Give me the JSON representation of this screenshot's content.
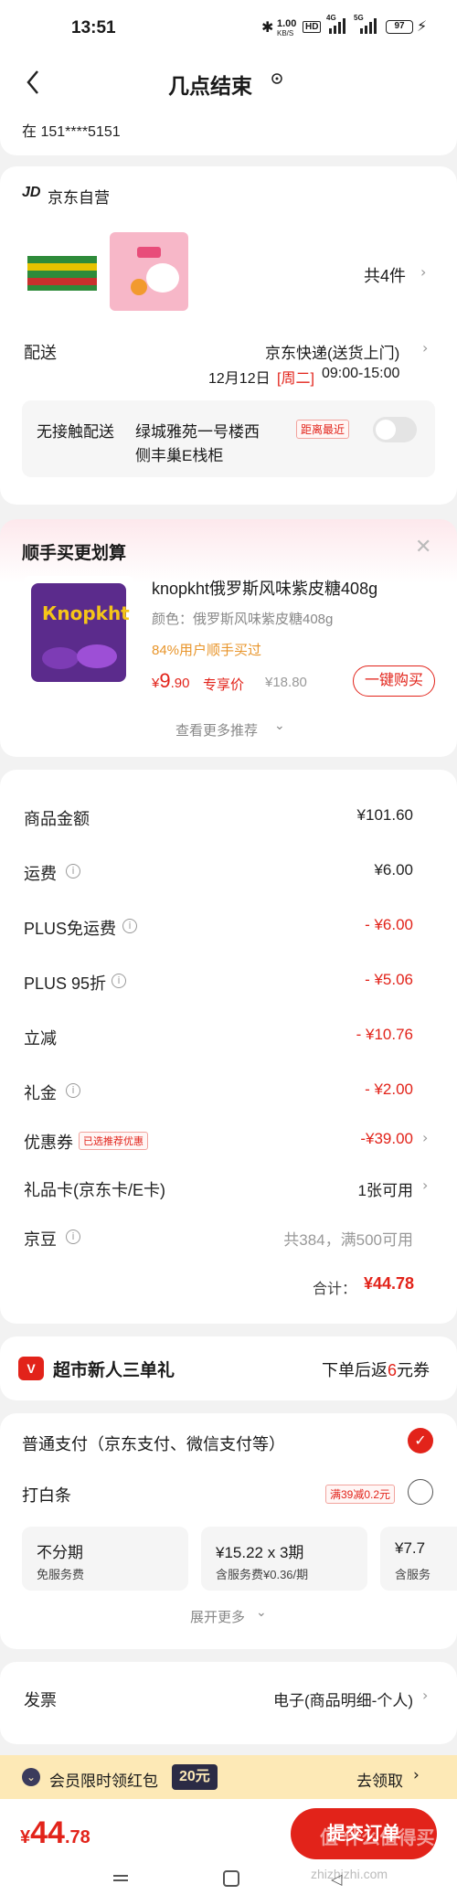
{
  "status_bar": {
    "time": "13:51",
    "net_speed_top": "1.00",
    "net_speed_unit": "KB/S",
    "hd": "HD",
    "sig1": "4G",
    "sig2": "5G",
    "battery": "97"
  },
  "header": {
    "title": "几点结束",
    "address_partial": "在  151****5151"
  },
  "store": {
    "logo": "JD",
    "name": "京东自营",
    "count_text": "共4件"
  },
  "delivery": {
    "label": "配送",
    "method": "京东快递(送货上门)",
    "date": "12月12日",
    "weekday": "[周二]",
    "time": "09:00-15:00",
    "contactless_label": "无接触配送",
    "location_line1": "绿城雅苑一号楼西",
    "location_line2": "侧丰巢E栈柜",
    "nearest_tag": "距离最近"
  },
  "addon": {
    "section_title": "顺手买更划算",
    "product_name": "knopkht俄罗斯风味紫皮糖408g",
    "variant": "颜色：俄罗斯风味紫皮糖408g",
    "social_proof": "84%用户顺手买过",
    "price_symbol": "¥",
    "price_int": "9",
    "price_dec": ".90",
    "price_tag": "专享价",
    "original_price": "¥18.80",
    "buy_button": "一键购买",
    "more": "查看更多推荐"
  },
  "summary": {
    "rows": [
      {
        "label": "商品金额",
        "value": "¥101.60",
        "red": false,
        "info": false
      },
      {
        "label": "运费",
        "value": "¥6.00",
        "red": false,
        "info": true
      },
      {
        "label": "PLUS免运费",
        "value": "- ¥6.00",
        "red": true,
        "info": true
      },
      {
        "label": "PLUS 95折",
        "value": "- ¥5.06",
        "red": true,
        "info": true
      },
      {
        "label": "立减",
        "value": "- ¥10.76",
        "red": true,
        "info": false
      },
      {
        "label": "礼金",
        "value": "- ¥2.00",
        "red": true,
        "info": true
      }
    ],
    "coupon_label": "优惠券",
    "coupon_tag": "已选推荐优惠",
    "coupon_value": "-¥39.00",
    "giftcard_label": "礼品卡(京东卡/E卡)",
    "giftcard_value": "1张可用",
    "jd_bean_label": "京豆",
    "jd_bean_value": "共384，满500可用",
    "total_label": "合计：",
    "total_value": "¥44.78"
  },
  "newcomer": {
    "title": "超市新人三单礼",
    "right_prefix": "下单后返",
    "right_amount": "6",
    "right_suffix": "元券"
  },
  "payment": {
    "normal_label": "普通支付（京东支付、微信支付等）",
    "baitiao_label": "打白条",
    "baitiao_tag": "满39减0.2元",
    "plans": [
      {
        "title": "不分期",
        "sub": "免服务费"
      },
      {
        "title": "¥15.22 x 3期",
        "sub": "含服务费¥0.36/期"
      },
      {
        "title": "¥7.7",
        "sub": "含服务"
      }
    ],
    "expand": "展开更多"
  },
  "invoice": {
    "label": "发票",
    "value": "电子(商品明细-个人)"
  },
  "member_banner": {
    "text": "会员限时领红包",
    "amount": "20元",
    "action": "去领取"
  },
  "bottom_bar": {
    "price_symbol": "¥",
    "price_int": "44",
    "price_dec": ".78",
    "submit": "提交订单",
    "watermark": "值 什么值得买",
    "site": "zhizhizhi.com"
  },
  "colors": {
    "accent": "#e2231a",
    "bg": "#f2f2f2",
    "banner": "#fde9b6"
  }
}
